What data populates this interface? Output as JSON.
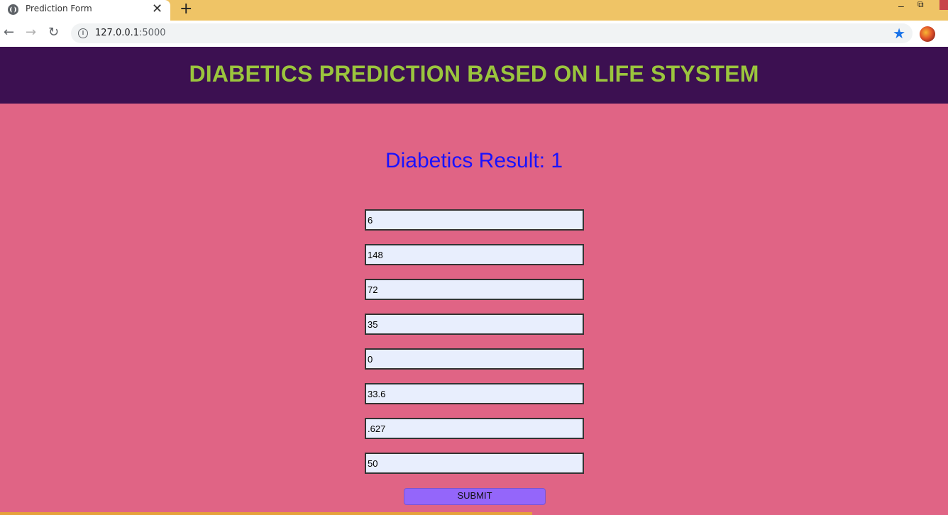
{
  "browser": {
    "tab_title": "Prediction Form",
    "tab_close": "✕",
    "new_tab": "+",
    "back": "←",
    "forward": "→",
    "reload": "↻",
    "info": "i",
    "url_host": "127.0.0.1",
    "url_port": ":5000",
    "star": "★",
    "minimize": "–",
    "maximize": "⧉"
  },
  "header": {
    "title": "DIABETICS PREDICTION BASED ON LIFE STYSTEM"
  },
  "result": {
    "text": "Diabetics Result: 1"
  },
  "form": {
    "fields": [
      "6",
      "148",
      "72",
      "35",
      "0",
      "33.6",
      ".627",
      "50"
    ],
    "submit_label": "SUBMIT"
  },
  "colors": {
    "page_bg": "#e06485",
    "header_bg": "#3c1051",
    "title": "#9bc53d",
    "result": "#1a12ff",
    "button": "#9466fa"
  }
}
